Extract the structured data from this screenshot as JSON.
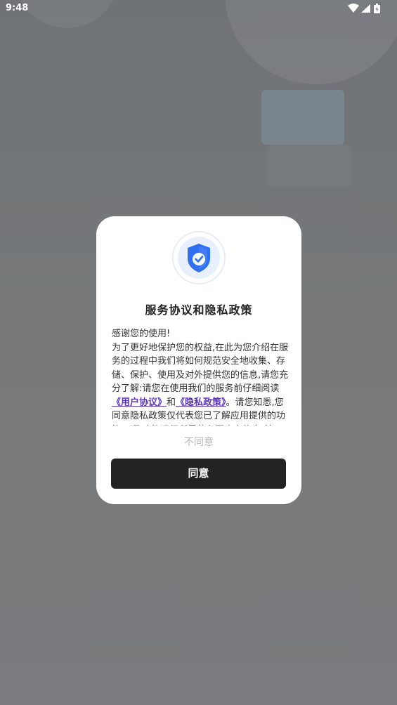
{
  "status_bar": {
    "time": "9:48",
    "icons": [
      "wifi-icon",
      "signal-icon",
      "battery-icon"
    ]
  },
  "dialog": {
    "icon": "shield-check-icon",
    "title": "服务协议和隐私政策",
    "body": {
      "greeting": "感谢您的使用!",
      "text_before_links": "为了更好地保护您的权益,在此为您介绍在服务的过程中我们将如何规范安全地收集、存储、保护、使用及对外提供您的信息,请您充分了解:请您在使用我们的服务前仔细阅读",
      "user_agreement_link": "《用户协议》",
      "and_text": "和",
      "privacy_policy_link": "《隐私政策》",
      "text_after_links": "。请您知悉,您同意隐私政策仅代表您已了解应用提供的功能,以及功能运行所需的必要个人信息,并不代表您已同意我们可以收集非必要个人信息。"
    },
    "disagree_label": "不同意",
    "agree_label": "同意"
  },
  "colors": {
    "overlay": "#7a7b7e",
    "dialog_bg": "#ffffff",
    "link": "#5a34b8",
    "primary_button": "#232323",
    "shield_blue": "#2f6ff0"
  }
}
